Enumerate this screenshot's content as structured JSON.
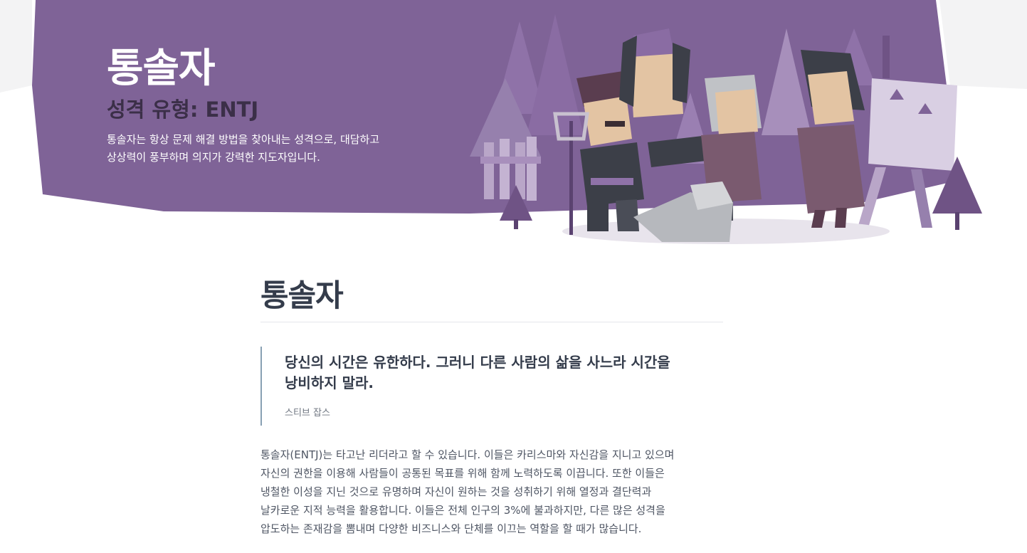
{
  "hero": {
    "title": "통솔자",
    "subtitle": "성격 유형: ENTJ",
    "desc_line1": "통솔자는 항상 문제 해결 방법을 찾아내는 성격으로, 대담하고",
    "desc_line2": "상상력이 풍부하며 의지가 강력한 지도자입니다."
  },
  "main": {
    "section_title": "통솔자",
    "quote": {
      "line1": "당신의 시간은 유한하다. 그러니 다른 사람의 삶을 사느라 시간을",
      "line2": "낭비하지 말라.",
      "author": "스티브 잡스"
    },
    "body_lines": [
      "통솔자(ENTJ)는 타고난 리더라고 할 수 있습니다. 이들은 카리스마와 자신감을 지니고 있으며",
      "자신의 권한을 이용해 사람들이 공통된 목표를 위해 함께 노력하도록 이끕니다. 또한 이들은",
      "냉철한 이성을 지닌 것으로 유명하며 자신이 원하는 것을 성취하기 위해 열정과 결단력과",
      "날카로운 지적 능력을 활용합니다. 이들은 전체 인구의 3%에 불과하지만, 다른 많은 성격을",
      "압도하는 존재감을 뽐내며 다양한 비즈니스와 단체를 이끄는 역할을 할 때가 많습니다."
    ]
  },
  "colors": {
    "banner": "#7f6397",
    "subtitle": "#3b2f48",
    "quote_border": "#88a0b3"
  }
}
